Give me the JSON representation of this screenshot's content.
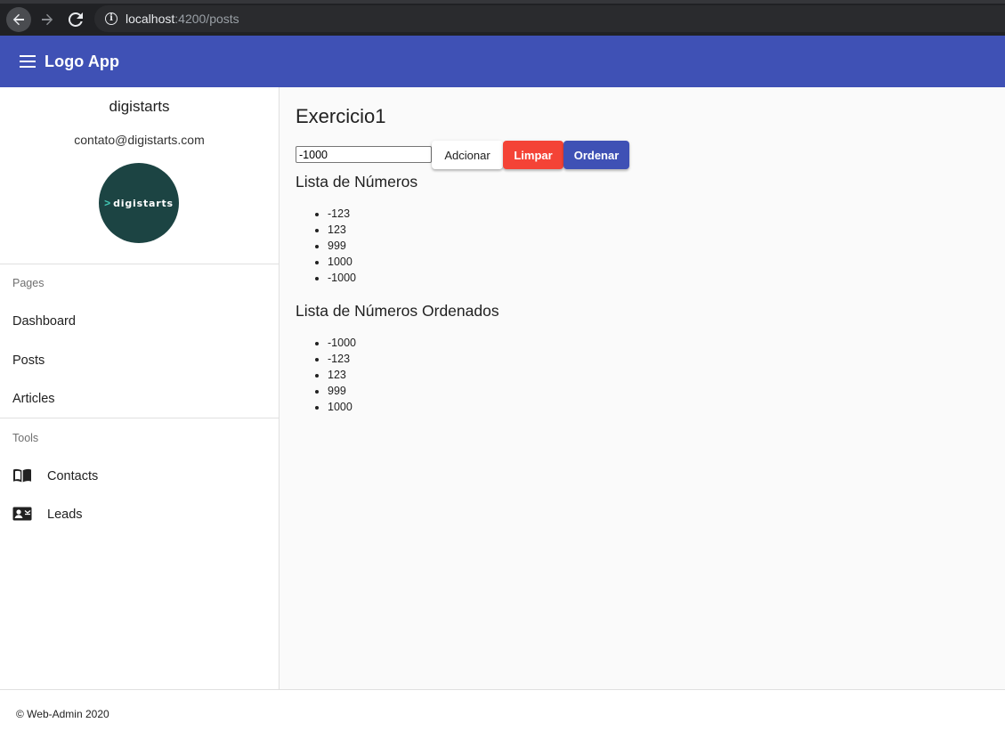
{
  "browser": {
    "url_host": "localhost",
    "url_rest": ":4200/posts"
  },
  "appbar": {
    "title": "Logo App"
  },
  "sidebar": {
    "profile_name": "digistarts",
    "profile_email": "contato@digistarts.com",
    "avatar_text": "digistarts",
    "pages_label": "Pages",
    "pages": [
      {
        "label": "Dashboard"
      },
      {
        "label": "Posts"
      },
      {
        "label": "Articles"
      }
    ],
    "tools_label": "Tools",
    "tools": [
      {
        "label": "Contacts",
        "icon": "book-icon"
      },
      {
        "label": "Leads",
        "icon": "contact-card-icon"
      }
    ]
  },
  "main": {
    "title": "Exercicio1",
    "input_value": "-1000",
    "add_label": "Adcionar",
    "clear_label": "Limpar",
    "sort_label": "Ordenar",
    "list_heading": "Lista de Números",
    "numbers": [
      "-123",
      "123",
      "999",
      "1000",
      "-1000"
    ],
    "sorted_heading": "Lista de Números Ordenados",
    "sorted_numbers": [
      "-1000",
      "-123",
      "123",
      "999",
      "1000"
    ]
  },
  "footer": {
    "text": "© Web-Admin 2020"
  },
  "colors": {
    "primary": "#3f51b5",
    "warn": "#f44336",
    "avatar_bg": "#1c4443"
  }
}
